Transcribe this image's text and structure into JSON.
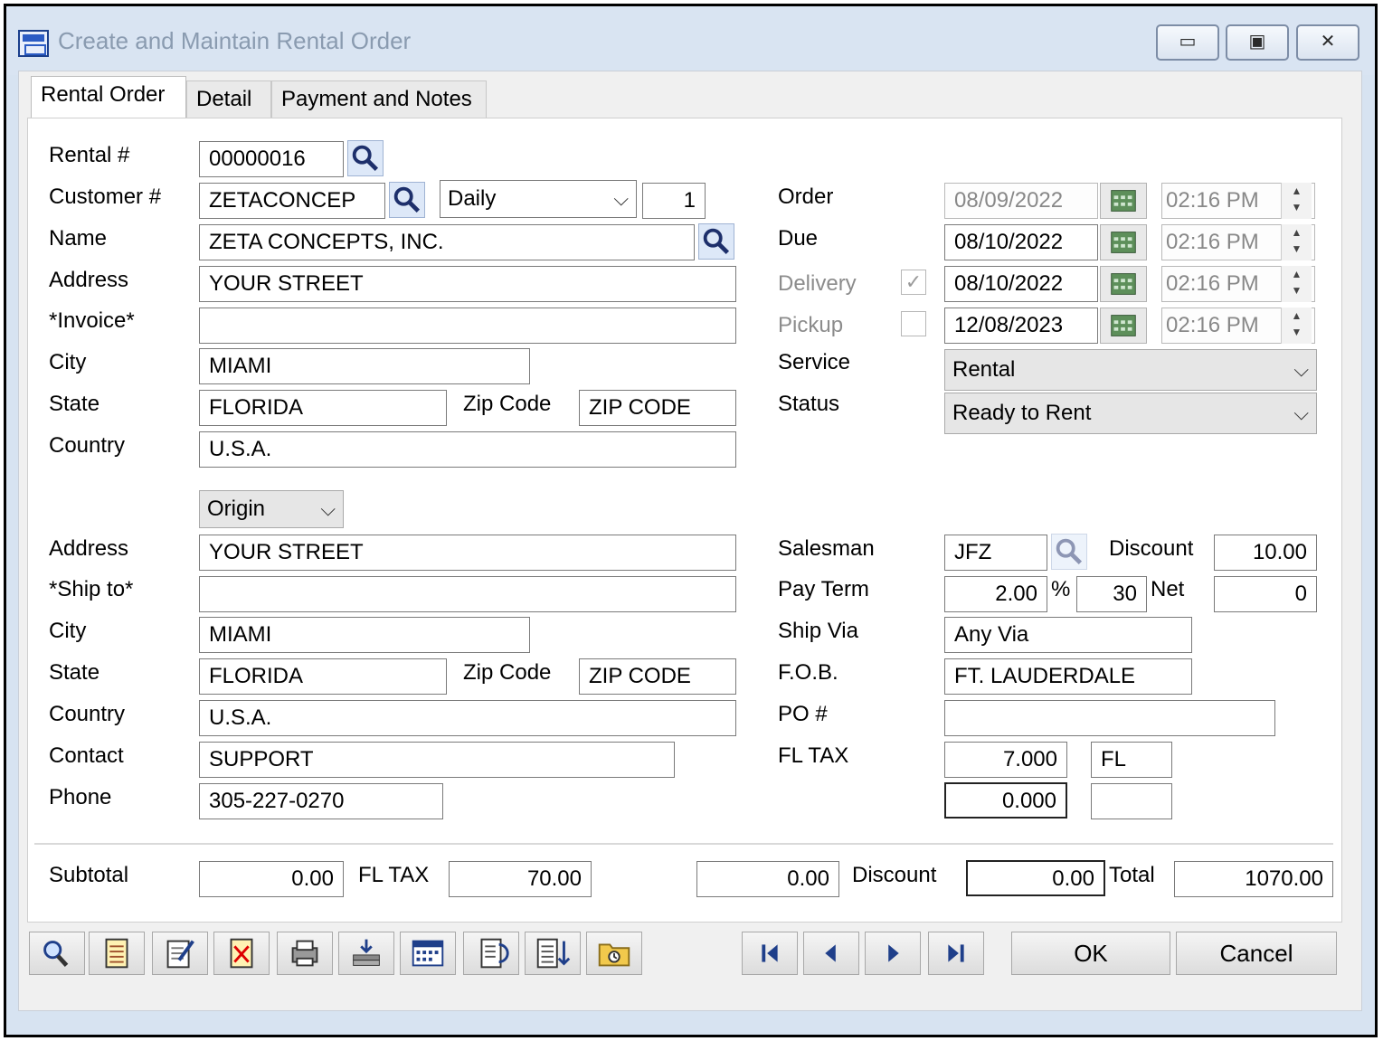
{
  "window": {
    "title": "Create and Maintain Rental Order",
    "minimize": "▭",
    "maximize": "▣",
    "close": "✕"
  },
  "tabs": [
    "Rental Order",
    "Detail",
    "Payment and Notes"
  ],
  "labels": {
    "rental": "Rental #",
    "customer": "Customer #",
    "name": "Name",
    "address": "Address",
    "invoice": "*Invoice*",
    "city": "City",
    "state": "State",
    "zip": "Zip Code",
    "country": "Country",
    "ship_address": "Address",
    "ship_to": "*Ship to*",
    "ship_city": "City",
    "ship_state": "State",
    "ship_zip": "Zip Code",
    "ship_country": "Country",
    "contact": "Contact",
    "phone": "Phone",
    "order": "Order",
    "due": "Due",
    "delivery": "Delivery",
    "pickup": "Pickup",
    "service": "Service",
    "status": "Status",
    "salesman": "Salesman",
    "discount": "Discount",
    "pay_term": "Pay Term",
    "percent": "%",
    "net": "Net",
    "ship_via": "Ship Via",
    "fob": "F.O.B.",
    "po": "PO #",
    "fl_tax": "FL TAX",
    "subtotal": "Subtotal",
    "tot_fl_tax": "FL TAX",
    "tot_discount": "Discount",
    "total": "Total"
  },
  "bill_to": {
    "rental_no": "00000016",
    "customer_no": "ZETACONCEP",
    "rate_period": "Daily",
    "rate_qty": "1",
    "name": "ZETA CONCEPTS, INC.",
    "address": "YOUR STREET",
    "invoice": "",
    "city": "MIAMI",
    "state": "FLORIDA",
    "zip": "ZIP CODE",
    "country": "U.S.A."
  },
  "ship_to": {
    "address_type": "Origin",
    "address": "YOUR STREET",
    "ship_to": "",
    "city": "MIAMI",
    "state": "FLORIDA",
    "zip": "ZIP CODE",
    "country": "U.S.A.",
    "contact": "SUPPORT",
    "phone": "305-227-0270"
  },
  "dates": {
    "order_date": "08/09/2022",
    "order_time": "02:16 PM",
    "due_date": "08/10/2022",
    "due_time": "02:16 PM",
    "delivery_checked": "✓",
    "delivery_date": "08/10/2022",
    "delivery_time": "02:16 PM",
    "pickup_checked": "",
    "pickup_date": "12/08/2023",
    "pickup_time": "02:16 PM",
    "service": "Rental",
    "status": "Ready to Rent"
  },
  "terms": {
    "salesman": "JFZ",
    "discount": "10.00",
    "pay_term_pct": "2.00",
    "pay_term_days": "30",
    "net": "0",
    "ship_via": "Any Via",
    "fob": "FT. LAUDERDALE",
    "po": "",
    "tax_rate": "7.000",
    "tax_code": "FL",
    "tax_rate2": "0.000",
    "tax_code2": ""
  },
  "totals": {
    "subtotal": "0.00",
    "fl_tax": "70.00",
    "other": "0.00",
    "discount": "0.00",
    "total": "1070.00"
  },
  "buttons": {
    "ok": "OK",
    "cancel": "Cancel"
  },
  "icons": {
    "lookup": "magnifier-icon",
    "calendar": "calendar-icon",
    "dropdown": "chevron-down-icon"
  }
}
